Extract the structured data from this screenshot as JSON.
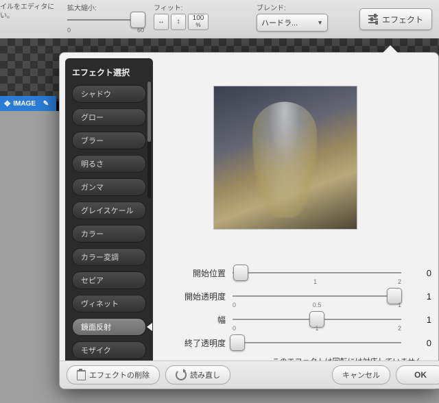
{
  "topbar": {
    "hint": "イルをエディタに\nい。",
    "zoom": {
      "label": "拡大縮小:",
      "min": "0",
      "max": "60"
    },
    "fit": {
      "label": "フィット:",
      "pct": "100",
      "pct_unit": "%"
    },
    "blend": {
      "label": "ブレンド:",
      "value": "ハードラ..."
    },
    "effect_btn": "エフェクト"
  },
  "image_tab": "IMAGE",
  "panel": {
    "title": "エフェクト選択",
    "items": [
      "シャドウ",
      "グロー",
      "ブラー",
      "明るさ",
      "ガンマ",
      "グレイスケール",
      "カラー",
      "カラー変調",
      "セピア",
      "ヴィネット",
      "鏡面反射",
      "モザイク"
    ],
    "selected_index": 10
  },
  "sliders": [
    {
      "label": "開始位置",
      "value": "0",
      "ticks": [
        "",
        "1",
        "2"
      ],
      "pos": 5
    },
    {
      "label": "開始透明度",
      "value": "1",
      "ticks": [
        "0",
        "0.5",
        "1"
      ],
      "pos": 96
    },
    {
      "label": "幅",
      "value": "1",
      "ticks": [
        "0",
        "1",
        "2"
      ],
      "pos": 50
    },
    {
      "label": "終了透明度",
      "value": "0",
      "ticks": [
        "",
        "",
        ""
      ],
      "pos": 3
    }
  ],
  "note": "このエフェクトは回転には対応していません。",
  "footer": {
    "delete": "エフェクトの削除",
    "reset": "読み直し",
    "cancel": "キャンセル",
    "ok": "OK"
  }
}
